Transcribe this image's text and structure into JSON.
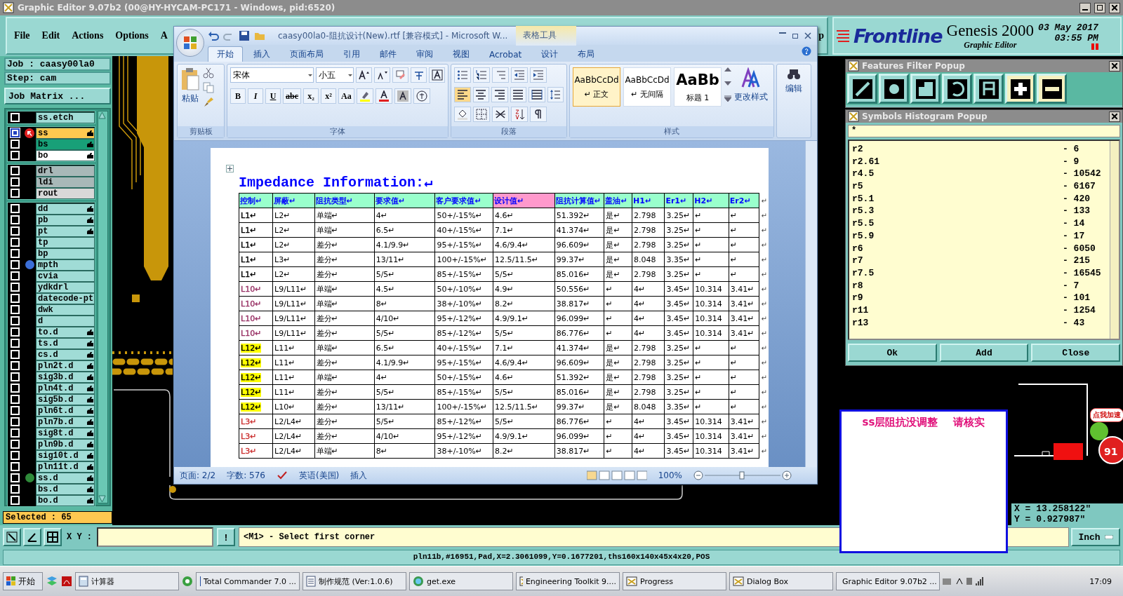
{
  "window": {
    "title": "Graphic Editor 9.07b2 (00@HY-HYCAM-PC171 - Windows, pid:6520)"
  },
  "menu": [
    "File",
    "Edit",
    "Actions",
    "Options",
    "A",
    "p"
  ],
  "header": {
    "logo": "Frontline",
    "product": "Genesis 2000",
    "subtitle": "Graphic Editor",
    "date": "03 May 2017",
    "time": "03:55 PM"
  },
  "job": {
    "job": "Job : caasy00la0",
    "step": "Step: cam",
    "matrix_button": "Job Matrix ..."
  },
  "layer_groups": [
    [
      {
        "name": "ss.etch",
        "color": "#a0dcd6",
        "hand": false,
        "selected": false
      }
    ],
    [
      {
        "name": "ss",
        "color": "#ffc850",
        "hand": true,
        "selected": true
      },
      {
        "name": "bs",
        "color": "#18a078",
        "hand": true,
        "selected": false
      },
      {
        "name": "bo",
        "color": "#ffffff",
        "hand": true,
        "selected": false
      }
    ],
    [
      {
        "name": "drl",
        "color": "#a8b8b8",
        "hand": false,
        "selected": false
      },
      {
        "name": "ldi",
        "color": "#a8b8b8",
        "hand": false,
        "selected": false
      },
      {
        "name": "rout",
        "color": "#d8d8d8",
        "hand": false,
        "selected": false
      }
    ],
    [
      {
        "name": "dd",
        "color": "#a0dcd6",
        "hand": true,
        "selected": false
      },
      {
        "name": "pb",
        "color": "#a0dcd6",
        "hand": true,
        "selected": false
      },
      {
        "name": "pt",
        "color": "#a0dcd6",
        "hand": true,
        "selected": false
      },
      {
        "name": "tp",
        "color": "#a0dcd6",
        "hand": false,
        "selected": false
      },
      {
        "name": "bp",
        "color": "#a0dcd6",
        "hand": false,
        "selected": false
      },
      {
        "name": "mpth",
        "color": "#a0dcd6",
        "hand": false,
        "selected": false,
        "dot": {
          "color": "#3b6fd8"
        }
      },
      {
        "name": "cvia",
        "color": "#a0dcd6",
        "hand": false,
        "selected": false
      },
      {
        "name": "ydkdrl",
        "color": "#a0dcd6",
        "hand": false,
        "selected": false
      },
      {
        "name": "datecode-pt",
        "color": "#a0dcd6",
        "hand": false,
        "selected": false
      },
      {
        "name": "dwk",
        "color": "#a0dcd6",
        "hand": false,
        "selected": false
      },
      {
        "name": "d",
        "color": "#a0dcd6",
        "hand": false,
        "selected": false
      },
      {
        "name": "to.d",
        "color": "#a0dcd6",
        "hand": true,
        "selected": false
      },
      {
        "name": "ts.d",
        "color": "#a0dcd6",
        "hand": true,
        "selected": false
      },
      {
        "name": "cs.d",
        "color": "#a0dcd6",
        "hand": true,
        "selected": false
      },
      {
        "name": "pln2t.d",
        "color": "#a0dcd6",
        "hand": true,
        "selected": false
      },
      {
        "name": "sig3b.d",
        "color": "#a0dcd6",
        "hand": true,
        "selected": false
      },
      {
        "name": "pln4t.d",
        "color": "#a0dcd6",
        "hand": true,
        "selected": false
      },
      {
        "name": "sig5b.d",
        "color": "#a0dcd6",
        "hand": true,
        "selected": false
      },
      {
        "name": "pln6t.d",
        "color": "#a0dcd6",
        "hand": true,
        "selected": false
      },
      {
        "name": "pln7b.d",
        "color": "#a0dcd6",
        "hand": true,
        "selected": false
      },
      {
        "name": "sig8t.d",
        "color": "#a0dcd6",
        "hand": true,
        "selected": false
      },
      {
        "name": "pln9b.d",
        "color": "#a0dcd6",
        "hand": true,
        "selected": false
      },
      {
        "name": "sig10t.d",
        "color": "#a0dcd6",
        "hand": true,
        "selected": false
      },
      {
        "name": "pln11t.d",
        "color": "#a0dcd6",
        "hand": true,
        "selected": false
      },
      {
        "name": "ss.d",
        "color": "#a0dcd6",
        "hand": true,
        "selected": false,
        "dot": {
          "color": "#2f8a3a"
        }
      },
      {
        "name": "bs.d",
        "color": "#a0dcd6",
        "hand": true,
        "selected": false
      },
      {
        "name": "bo.d",
        "color": "#a0dcd6",
        "hand": true,
        "selected": false
      }
    ]
  ],
  "selected_count": "Selected : 65",
  "word": {
    "title": "caasy00la0-阻抗设计(New).rtf [兼容模式] - Microsoft W...",
    "context_tab": "表格工具",
    "tabs": [
      {
        "label": "开始",
        "selected": true
      },
      {
        "label": "插入",
        "selected": false
      },
      {
        "label": "页面布局",
        "selected": false
      },
      {
        "label": "引用",
        "selected": false
      },
      {
        "label": "邮件",
        "selected": false
      },
      {
        "label": "审阅",
        "selected": false
      },
      {
        "label": "视图",
        "selected": false
      },
      {
        "label": "Acrobat",
        "selected": false
      },
      {
        "label": "设计",
        "selected": false
      },
      {
        "label": "布局",
        "selected": false
      }
    ],
    "clipboard": {
      "paste": "粘贴",
      "label": "剪贴板"
    },
    "font": {
      "name": "宋体",
      "size": "小五",
      "label": "字体",
      "buttons": [
        "B",
        "I",
        "U",
        "abc",
        "x₂",
        "x²",
        "Aa"
      ]
    },
    "paragraph": {
      "label": "段落"
    },
    "styles": {
      "label": "样式",
      "change": "更改样式",
      "items": [
        {
          "sample": "AaBbCcDd",
          "name": "↵ 正文",
          "selected": true
        },
        {
          "sample": "AaBbCcDd",
          "name": "↵ 无间隔",
          "selected": false
        },
        {
          "sample": "AaBb",
          "name": "标题 1",
          "selected": false
        }
      ]
    },
    "editing": "编辑",
    "heading": "Impedance Information:↵",
    "table": {
      "columns": [
        {
          "label": "控制↵",
          "color": "#99ffcc"
        },
        {
          "label": "屏蔽↵",
          "color": "#99ffcc"
        },
        {
          "label": "阻抗类型↵",
          "color": "#99ffcc"
        },
        {
          "label": "要求值↵",
          "color": "#99ffcc"
        },
        {
          "label": "客户要求值↵",
          "color": "#99ffcc"
        },
        {
          "label": "设计值↵",
          "color": "#ff99cc"
        },
        {
          "label": "阻抗计算值↵",
          "color": "#99ffcc"
        },
        {
          "label": "盖油↵",
          "color": "#99ffcc"
        },
        {
          "label": "H1↵",
          "color": "#99ffcc"
        },
        {
          "label": "Er1↵",
          "color": "#99ffcc"
        },
        {
          "label": "H2↵",
          "color": "#99ffcc"
        },
        {
          "label": "Er2↵",
          "color": "#99ffcc"
        }
      ],
      "header_end": "↵",
      "rows": [
        {
          "color": "#000000",
          "highlight": false,
          "cells": [
            "L1↵",
            "L2↵",
            "单端↵",
            "4↵",
            "50+/-15%↵",
            "4.6↵",
            "51.392↵",
            "是↵",
            "2.798",
            "3.25↵",
            "↵",
            "↵"
          ],
          "end": "↵"
        },
        {
          "color": "#000000",
          "highlight": false,
          "cells": [
            "L1↵",
            "L2↵",
            "单端↵",
            "6.5↵",
            "40+/-15%↵",
            "7.1↵",
            "41.374↵",
            "是↵",
            "2.798",
            "3.25↵",
            "↵",
            "↵"
          ],
          "end": "↵"
        },
        {
          "color": "#000000",
          "highlight": false,
          "cells": [
            "L1↵",
            "L2↵",
            "差分↵",
            "4.1/9.9↵",
            "95+/-15%↵",
            "4.6/9.4↵",
            "96.609↵",
            "是↵",
            "2.798",
            "3.25↵",
            "↵",
            "↵"
          ],
          "end": "↵"
        },
        {
          "color": "#000000",
          "highlight": false,
          "cells": [
            "L1↵",
            "L3↵",
            "差分↵",
            "13/11↵",
            "100+/-15%↵",
            "12.5/11.5↵",
            "99.37↵",
            "是↵",
            "8.048",
            "3.35↵",
            "↵",
            "↵"
          ],
          "end": "↵"
        },
        {
          "color": "#000000",
          "highlight": false,
          "cells": [
            "L1↵",
            "L2↵",
            "差分↵",
            "5/5↵",
            "85+/-15%↵",
            "5/5↵",
            "85.016↵",
            "是↵",
            "2.798",
            "3.25↵",
            "↵",
            "↵"
          ],
          "end": "↵"
        },
        {
          "color": "#993366",
          "highlight": false,
          "cells": [
            "L10↵",
            "L9/L11↵",
            "单端↵",
            "4.5↵",
            "50+/-10%↵",
            "4.9↵",
            "50.556↵",
            "↵",
            "4↵",
            "3.45↵",
            "10.314",
            "3.41↵"
          ],
          "end": "↵"
        },
        {
          "color": "#993366",
          "highlight": false,
          "cells": [
            "L10↵",
            "L9/L11↵",
            "单端↵",
            "8↵",
            "38+/-10%↵",
            "8.2↵",
            "38.817↵",
            "↵",
            "4↵",
            "3.45↵",
            "10.314",
            "3.41↵"
          ],
          "end": "↵"
        },
        {
          "color": "#993366",
          "highlight": false,
          "cells": [
            "L10↵",
            "L9/L11↵",
            "差分↵",
            "4/10↵",
            "95+/-12%↵",
            "4.9/9.1↵",
            "96.099↵",
            "↵",
            "4↵",
            "3.45↵",
            "10.314",
            "3.41↵"
          ],
          "end": "↵"
        },
        {
          "color": "#993366",
          "highlight": false,
          "cells": [
            "L10↵",
            "L9/L11↵",
            "差分↵",
            "5/5↵",
            "85+/-12%↵",
            "5/5↵",
            "86.776↵",
            "↵",
            "4↵",
            "3.45↵",
            "10.314",
            "3.41↵"
          ],
          "end": "↵"
        },
        {
          "highlight": true,
          "cells": [
            "L12↵",
            "L11↵",
            "单端↵",
            "6.5↵",
            "40+/-15%↵",
            "7.1↵",
            "41.374↵",
            "是↵",
            "2.798",
            "3.25↵",
            "↵",
            "↵"
          ],
          "end": "↵"
        },
        {
          "highlight": true,
          "cells": [
            "L12↵",
            "L11↵",
            "差分↵",
            "4.1/9.9↵",
            "95+/-15%↵",
            "4.6/9.4↵",
            "96.609↵",
            "是↵",
            "2.798",
            "3.25↵",
            "↵",
            "↵"
          ],
          "end": "↵"
        },
        {
          "highlight": true,
          "cells": [
            "L12↵",
            "L11↵",
            "单端↵",
            "4↵",
            "50+/-15%↵",
            "4.6↵",
            "51.392↵",
            "是↵",
            "2.798",
            "3.25↵",
            "↵",
            "↵"
          ],
          "end": "↵"
        },
        {
          "highlight": true,
          "cells": [
            "L12↵",
            "L11↵",
            "差分↵",
            "5/5↵",
            "85+/-15%↵",
            "5/5↵",
            "85.016↵",
            "是↵",
            "2.798",
            "3.25↵",
            "↵",
            "↵"
          ],
          "end": "↵"
        },
        {
          "highlight": true,
          "cells": [
            "L12↵",
            "L10↵",
            "差分↵",
            "13/11↵",
            "100+/-15%↵",
            "12.5/11.5↵",
            "99.37↵",
            "是↵",
            "8.048",
            "3.35↵",
            "↵",
            "↵"
          ],
          "end": "↵"
        },
        {
          "color": "#cc3333",
          "highlight": false,
          "cells": [
            "L3↵",
            "L2/L4↵",
            "差分↵",
            "5/5↵",
            "85+/-12%↵",
            "5/5↵",
            "86.776↵",
            "↵",
            "4↵",
            "3.45↵",
            "10.314",
            "3.41↵"
          ],
          "end": "↵"
        },
        {
          "color": "#cc3333",
          "highlight": false,
          "cells": [
            "L3↵",
            "L2/L4↵",
            "差分↵",
            "4/10↵",
            "95+/-12%↵",
            "4.9/9.1↵",
            "96.099↵",
            "↵",
            "4↵",
            "3.45↵",
            "10.314",
            "3.41↵"
          ],
          "end": "↵"
        },
        {
          "color": "#cc3333",
          "highlight": false,
          "cells": [
            "L3↵",
            "L2/L4↵",
            "单端↵",
            "8↵",
            "38+/-10%↵",
            "8.2↵",
            "38.817↵",
            "↵",
            "4↵",
            "3.45↵",
            "10.314",
            "3.41↵"
          ],
          "end": "↵"
        }
      ]
    },
    "status": {
      "page": "页面: 2/2",
      "words": "字数: 576",
      "language": "英语(美国)",
      "mode": "插入",
      "zoom": "100%"
    }
  },
  "features_filter": {
    "title": "Features Filter Popup",
    "filters": [
      {
        "kind": "line",
        "selected": false
      },
      {
        "kind": "pad",
        "selected": false
      },
      {
        "kind": "surface",
        "selected": false
      },
      {
        "kind": "arc",
        "selected": false
      },
      {
        "kind": "text",
        "selected": false
      },
      {
        "kind": "plus",
        "selected": true
      },
      {
        "kind": "minus",
        "selected": true
      }
    ]
  },
  "histogram": {
    "title": "Symbols Histogram Popup",
    "filter": "*",
    "rows": [
      {
        "symbol": "r2",
        "count": "- 6"
      },
      {
        "symbol": "r2.61",
        "count": "- 9"
      },
      {
        "symbol": "r4.5",
        "count": "- 10542"
      },
      {
        "symbol": "r5",
        "count": "- 6167"
      },
      {
        "symbol": "r5.1",
        "count": "- 420"
      },
      {
        "symbol": "r5.3",
        "count": "- 133"
      },
      {
        "symbol": "r5.5",
        "count": "- 14"
      },
      {
        "symbol": "r5.9",
        "count": "- 17"
      },
      {
        "symbol": "r6",
        "count": "- 6050"
      },
      {
        "symbol": "r7",
        "count": "- 215"
      },
      {
        "symbol": "r7.5",
        "count": "- 16545"
      },
      {
        "symbol": "r8",
        "count": "- 7"
      },
      {
        "symbol": "r9",
        "count": "- 101"
      },
      {
        "symbol": "r11",
        "count": "- 1254"
      },
      {
        "symbol": "r13",
        "count": "- 43"
      }
    ],
    "buttons": [
      "Ok",
      "Add",
      "Close"
    ]
  },
  "note": {
    "lines": [
      "ss层阻抗没调整",
      "请核实"
    ]
  },
  "widget": {
    "bubble": "点我加速",
    "badge": "91"
  },
  "coords": {
    "x": "X = 13.258122\"",
    "y": "Y = 0.927987\""
  },
  "command_bar": {
    "xy_label": "X Y :",
    "bang": "!",
    "prompt": "<M1> - Select first corner",
    "units": "Inch"
  },
  "status_line": "pln11b,#16951,Pad,X=2.3061099,Y=0.1677201,ths160x140x45x4x20,POS",
  "taskbar": {
    "start": "开始",
    "items": [
      {
        "label": "计算器",
        "kind": "calc",
        "selected": false
      },
      {
        "label": "Total Commander 7.0 ...",
        "kind": "disk",
        "selected": false
      },
      {
        "label": "制作规范 (Ver:1.0.6)",
        "kind": "doc",
        "selected": false
      },
      {
        "label": "get.exe",
        "kind": "globe",
        "selected": false
      },
      {
        "label": "Engineering Toolkit 9....",
        "kind": "app",
        "selected": false
      },
      {
        "label": "Progress",
        "kind": "app",
        "selected": false
      },
      {
        "label": "Dialog Box",
        "kind": "app",
        "selected": false
      },
      {
        "label": "Graphic Editor 9.07b2 ...",
        "kind": "app",
        "selected": false
      }
    ],
    "clock": "17:09"
  }
}
